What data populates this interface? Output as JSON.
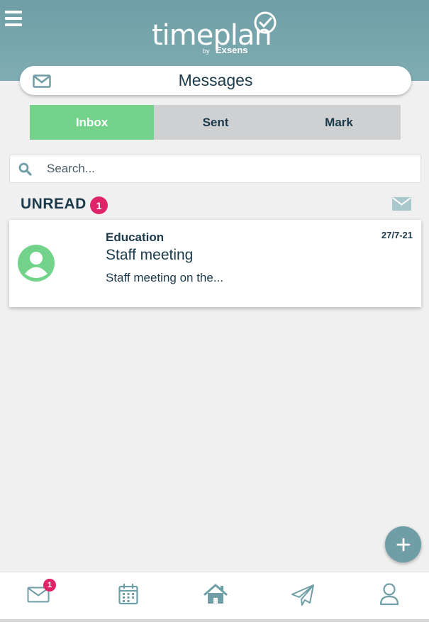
{
  "header": {
    "logo_text": "timeplan",
    "logo_by": "by",
    "logo_brand": "Exsens",
    "menu_icon": "hamburger-menu-icon",
    "background_color": "#7aa9b0"
  },
  "page": {
    "title": "Messages",
    "title_icon": "envelope-icon"
  },
  "tabs": [
    {
      "label": "Inbox",
      "active": true
    },
    {
      "label": "Sent",
      "active": false
    },
    {
      "label": "Mark",
      "active": false
    }
  ],
  "search": {
    "placeholder": "Search...",
    "value": "",
    "icon": "search-icon"
  },
  "section": {
    "label": "UNREAD",
    "count": "1",
    "action_icon": "envelope-icon"
  },
  "messages": [
    {
      "category": "Education",
      "subject": "Staff meeting",
      "preview": "Staff meeting on the...",
      "date": "27/7-21",
      "avatar_icon": "user-avatar-icon"
    }
  ],
  "fab": {
    "icon": "plus-icon"
  },
  "bottom_nav": {
    "items": [
      {
        "name": "messages",
        "icon": "envelope-icon",
        "badge": "1"
      },
      {
        "name": "calendar",
        "icon": "calendar-icon"
      },
      {
        "name": "home",
        "icon": "home-icon"
      },
      {
        "name": "sent",
        "icon": "paper-plane-icon"
      },
      {
        "name": "profile",
        "icon": "user-icon"
      }
    ]
  },
  "colors": {
    "accent_teal": "#6f9ea6",
    "active_tab": "#74d38a",
    "badge_pink": "#e0246a",
    "text_dark": "#1b3a4b",
    "avatar_green": "#74d38a"
  }
}
